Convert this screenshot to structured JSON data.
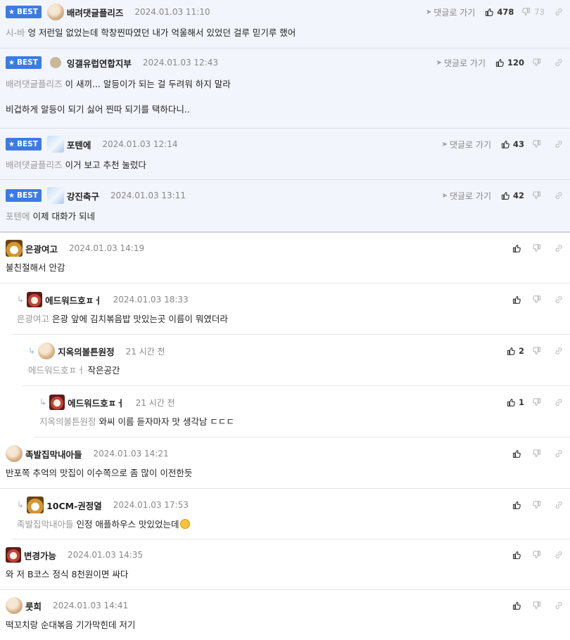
{
  "actions": {
    "goto_label": "댓글로 가기",
    "best_label": "BEST"
  },
  "comments": [
    {
      "author": "배려댓글플리즈",
      "date": "2024.01.03 11:10",
      "mention": "시-바",
      "body": "엉 저런일 없었는데 학창찐따였던 내가 억울해서 있었던 걸루 믿기루 했어",
      "likes": "478",
      "dislikes": "73"
    },
    {
      "author": "잉갤유럽연합지부",
      "date": "2024.01.03 12:43",
      "mention": "배려댓글플리즈",
      "body": "이 새끼... 알등이가 되는 걸 두려워 하지 말라\n\n비겁하게 알등이 되기 싫어 찐따 되기를 택하다니..",
      "likes": "120"
    },
    {
      "author": "포텐에",
      "date": "2024.01.03 12:14",
      "mention": "배려댓글플리즈",
      "body": "이거 보고 추천 눌렀다",
      "likes": "43"
    },
    {
      "author": "강진축구",
      "date": "2024.01.03 13:11",
      "mention": "포텐에",
      "body": "이제 대화가 되네",
      "likes": "42"
    },
    {
      "author": "은광여고",
      "date": "2024.01.03 14:19",
      "body": "불친절해서 안감"
    },
    {
      "author": "에드워드호ㅍㅓ",
      "date": "2024.01.03 18:33",
      "mention": "은광여고",
      "body": "은광 앞에 김치볶음밥 맛있는곳 이름이 뭐였더라"
    },
    {
      "author": "지옥의볼튼원정",
      "date": "21 시간 전",
      "mention": "에드워드호ㅍㅓ",
      "body": "작은공간",
      "likes": "2"
    },
    {
      "author": "에드워드호ㅍㅓ",
      "date": "21 시간 전",
      "mention": "지옥의볼튼원정",
      "body": "와씨 이름 듣자마자 맛 생각남 ㄷㄷㄷ",
      "likes": "1"
    },
    {
      "author": "족발집막내아들",
      "date": "2024.01.03 14:21",
      "body": "반포쪽 추억의 맛집이 이수쪽으로 좀 많이 이전한듯"
    },
    {
      "author": "10CM-권정열",
      "date": "2024.01.03 17:53",
      "mention": "족발집막내아들",
      "body": "인정 애플하우스 맛있었는데"
    },
    {
      "author": "변경가능",
      "date": "2024.01.03 14:35",
      "body": "와 저 B코스 정식 8천원이면 싸다"
    },
    {
      "author": "룻희",
      "date": "2024.01.03 14:41",
      "body": "떡꼬치랑 순대볶음 기가막힌데 저기"
    }
  ],
  "icons": {
    "like": "thumbs-up-icon",
    "dislike": "thumbs-down-icon",
    "link": "link-icon",
    "goto": "send-arrow-icon",
    "best": "star-icon"
  },
  "colors": {
    "best_badge": "#3d7be3",
    "best_bg": "#f2f5fb",
    "mention": "#999999"
  }
}
